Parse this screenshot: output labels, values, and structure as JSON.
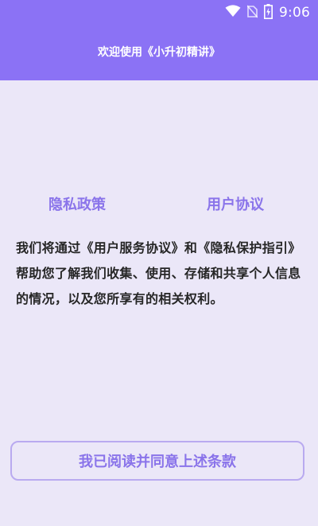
{
  "status_bar": {
    "time": "9:06",
    "icons": [
      "wifi-icon",
      "no-sim-icon",
      "battery-charging-icon"
    ]
  },
  "header": {
    "title": "欢迎使用《小升初精讲》",
    "background_color": "#8b72f5"
  },
  "tabs": {
    "privacy_label": "隐私政策",
    "agreement_label": "用户协议"
  },
  "content": {
    "text": "我们将通过《用户服务协议》和《隐私保护指引》帮助您了解我们收集、使用、存储和共享个人信息的情况，以及您所享有的相关权利。"
  },
  "agree_button": {
    "label": "我已阅读并同意上述条款"
  },
  "colors": {
    "accent": "#8a74ea",
    "page_background": "#ebe7f8",
    "button_border": "#b9aaf0"
  }
}
